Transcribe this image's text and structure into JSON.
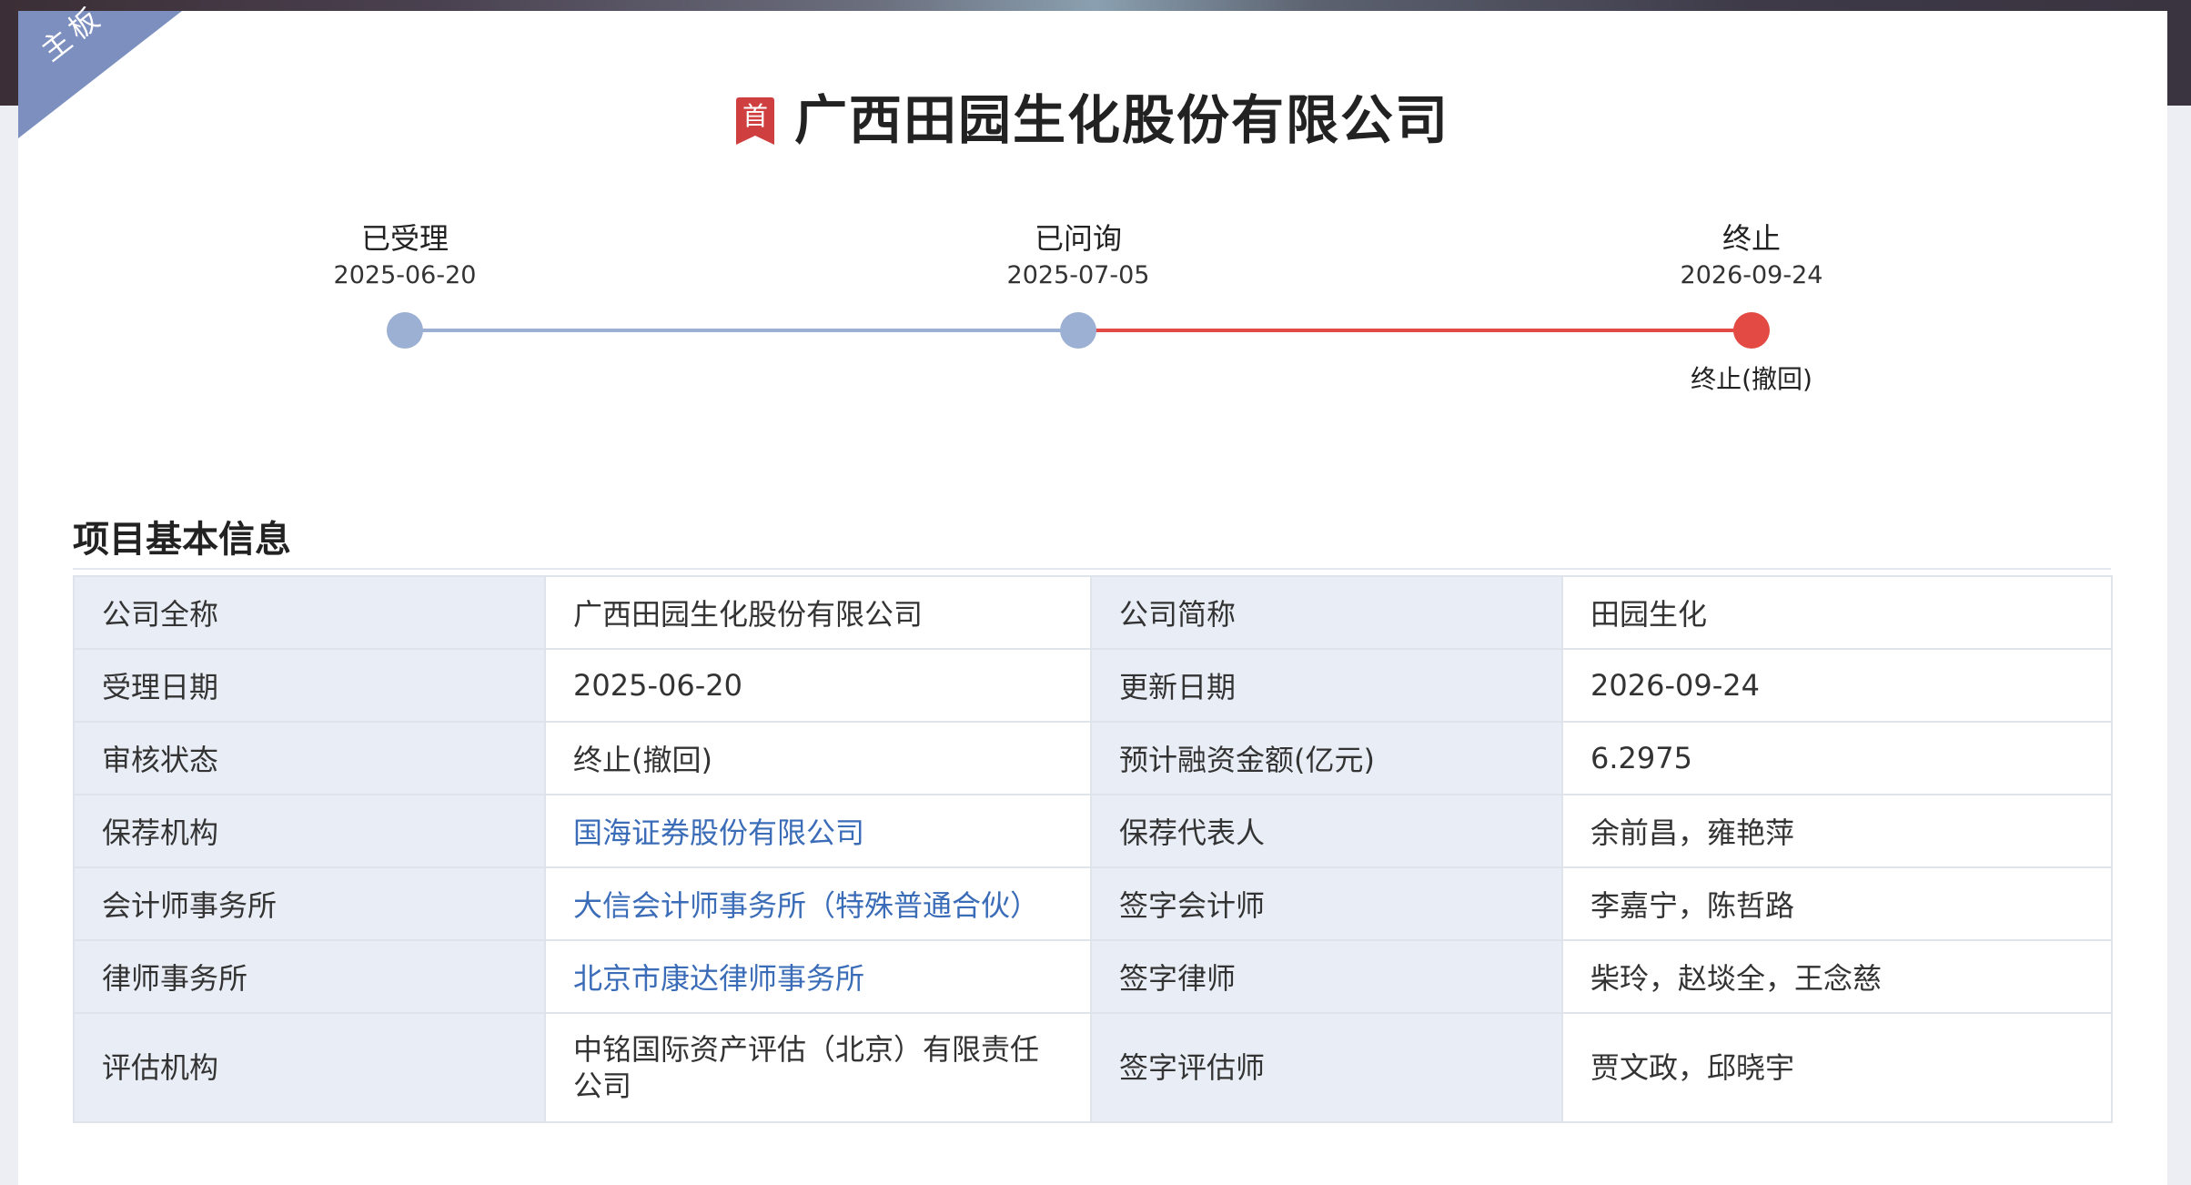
{
  "board_tag": "主板",
  "title_badge": "首",
  "company_title": "广西田园生化股份有限公司",
  "timeline": [
    {
      "label": "已受理",
      "date": "2025-06-20",
      "note": ""
    },
    {
      "label": "已问询",
      "date": "2025-07-05",
      "note": ""
    },
    {
      "label": "终止",
      "date": "2026-09-24",
      "note": "终止(撤回)"
    }
  ],
  "colors": {
    "accent_blue": "#9bb0d3",
    "accent_red": "#e24a43",
    "link": "#3b6cb8",
    "ribbon": "#7c8fbf",
    "badge": "#cf3f3f"
  },
  "section_title": "项目基本信息",
  "info_rows": [
    [
      {
        "k": "公司全称",
        "v": "广西田园生化股份有限公司"
      },
      {
        "k": "公司简称",
        "v": "田园生化"
      }
    ],
    [
      {
        "k": "受理日期",
        "v": "2025-06-20"
      },
      {
        "k": "更新日期",
        "v": "2026-09-24"
      }
    ],
    [
      {
        "k": "审核状态",
        "v": "终止(撤回)"
      },
      {
        "k": "预计融资金额(亿元)",
        "v": "6.2975"
      }
    ],
    [
      {
        "k": "保荐机构",
        "v": "国海证券股份有限公司"
      },
      {
        "k": "保荐代表人",
        "v": "余前昌，雍艳萍"
      }
    ],
    [
      {
        "k": "会计师事务所",
        "v": "大信会计师事务所（特殊普通合伙）"
      },
      {
        "k": "签字会计师",
        "v": "李嘉宁，陈哲路"
      }
    ],
    [
      {
        "k": "律师事务所",
        "v": "北京市康达律师事务所"
      },
      {
        "k": "签字律师",
        "v": "柴玲，赵埮全，王念慈"
      }
    ],
    [
      {
        "k": "评估机构",
        "v": "中铭国际资产评估（北京）有限责任公司"
      },
      {
        "k": "签字评估师",
        "v": "贾文政，邱晓宇"
      }
    ]
  ]
}
